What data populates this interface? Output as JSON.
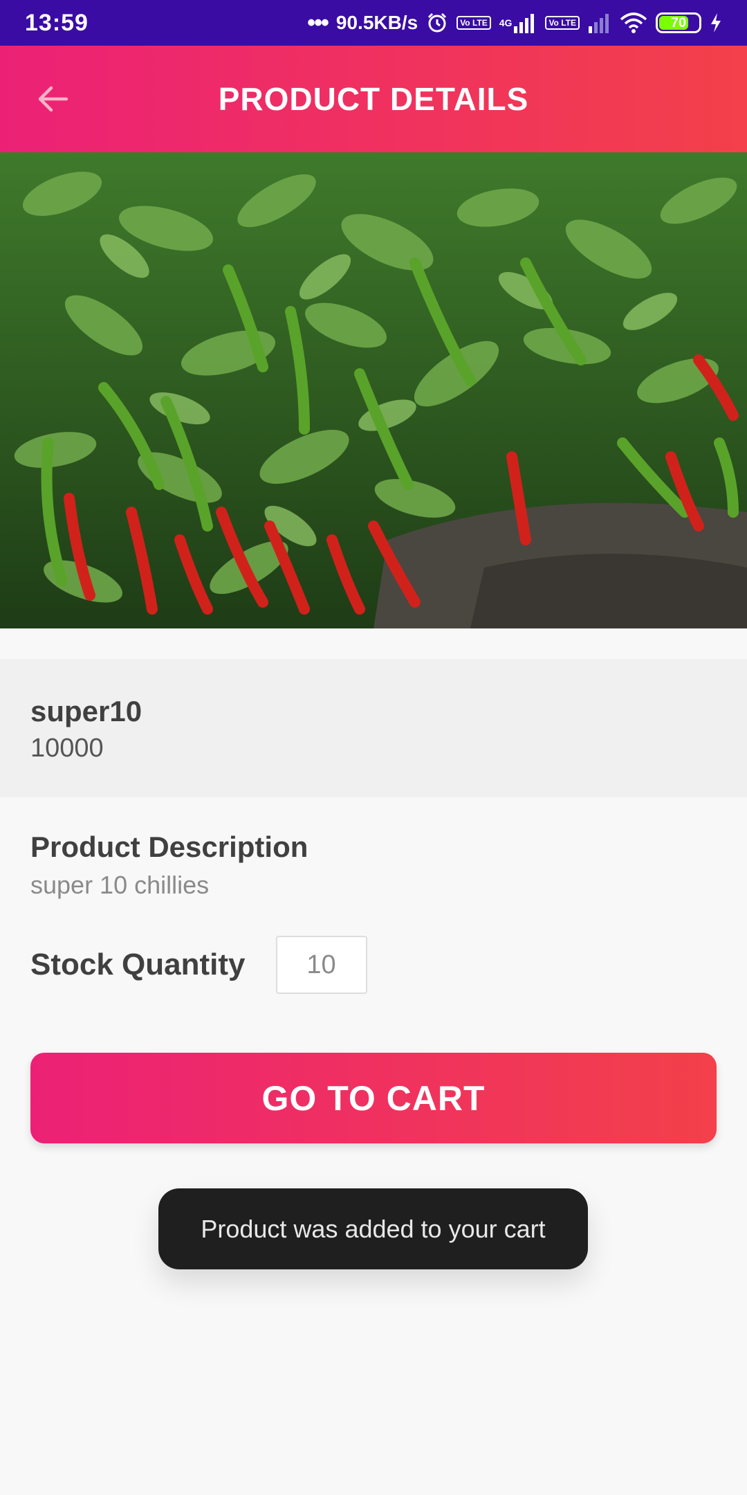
{
  "status_bar": {
    "time": "13:59",
    "network_speed": "90.5KB/s",
    "network_type": "4G",
    "volte1": "Vo LTE",
    "volte2": "Vo LTE",
    "battery": "70",
    "icons": [
      "alarm-icon",
      "signal-icon",
      "wifi-icon",
      "battery-icon",
      "charging-icon"
    ]
  },
  "app_bar": {
    "title": "PRODUCT DETAILS",
    "back_icon": "arrow-left-icon"
  },
  "product": {
    "image_subject": "chili-plants-image",
    "name": "super10",
    "price": "10000",
    "description_label": "Product Description",
    "description": "super 10 chillies",
    "stock_label": "Stock Quantity",
    "stock_value": "10"
  },
  "actions": {
    "go_to_cart": "GO TO CART"
  },
  "toast": {
    "message": "Product was added to your cart"
  },
  "colors": {
    "status_bar": "#3a0ca3",
    "gradient_start": "#ec2176",
    "gradient_end": "#f3404a",
    "toast_bg": "#1f1f1f"
  }
}
